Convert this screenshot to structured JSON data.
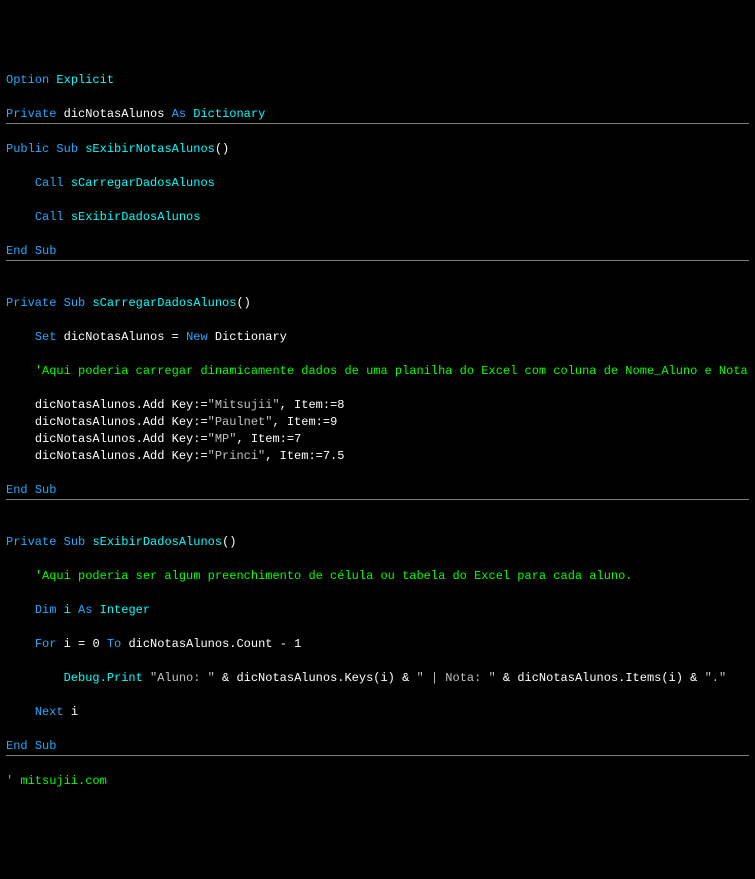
{
  "l1": {
    "a": "Option",
    "b": "Explicit"
  },
  "l3": {
    "a": "Private",
    "b": "dicNotasAlunos",
    "c": "As",
    "d": "Dictionary"
  },
  "l5": {
    "a": "Public",
    "b": "Sub",
    "c": "sExibirNotasAlunos",
    "d": "()"
  },
  "l7": {
    "a": "Call",
    "b": "sCarregarDadosAlunos"
  },
  "l9": {
    "a": "Call",
    "b": "sExibirDadosAlunos"
  },
  "l11": {
    "a": "End",
    "b": "Sub"
  },
  "l14": {
    "a": "Private",
    "b": "Sub",
    "c": "sCarregarDadosAlunos",
    "d": "()"
  },
  "l16": {
    "a": "Set",
    "b": "dicNotasAlunos",
    "c": "=",
    "d": "New",
    "e": "Dictionary"
  },
  "l18": {
    "a": "'Aqui poderia carregar dinamicamente dados de uma planilha do Excel com coluna de Nome_Aluno e Nota"
  },
  "l20": {
    "a": "dicNotasAlunos.Add Key:=",
    "b": "\"Mitsujii\"",
    "c": ", Item:=",
    "d": "8"
  },
  "l21": {
    "a": "dicNotasAlunos.Add Key:=",
    "b": "\"Paulnet\"",
    "c": ", Item:=",
    "d": "9"
  },
  "l22": {
    "a": "dicNotasAlunos.Add Key:=",
    "b": "\"MP\"",
    "c": ", Item:=",
    "d": "7"
  },
  "l23": {
    "a": "dicNotasAlunos.Add Key:=",
    "b": "\"Princi\"",
    "c": ", Item:=",
    "d": "7.5"
  },
  "l25": {
    "a": "End",
    "b": "Sub"
  },
  "l28": {
    "a": "Private",
    "b": "Sub",
    "c": "sExibirDadosAlunos",
    "d": "()"
  },
  "l30": {
    "a": "'Aqui poderia ser algum preenchimento de célula ou tabela do Excel para cada aluno."
  },
  "l32": {
    "a": "Dim",
    "b": "i",
    "c": "As",
    "d": "Integer"
  },
  "l34": {
    "a": "For",
    "b": "i",
    "c": "=",
    "d": "0",
    "e": "To",
    "f": "dicNotasAlunos.Count",
    "g": "-",
    "h": "1"
  },
  "l36": {
    "a": "Debug.Print",
    "b": "\"Aluno: \"",
    "c": "&",
    "d": "dicNotasAlunos.Keys(i)",
    "e": "&",
    "f": "\" | Nota: \"",
    "g": "&",
    "h": "dicNotasAlunos.Items(i)",
    "i": "&",
    "j": "\".\""
  },
  "l38": {
    "a": "Next",
    "b": "i"
  },
  "l40": {
    "a": "End",
    "b": "Sub"
  },
  "l42": {
    "a": "' mitsujii.com"
  }
}
